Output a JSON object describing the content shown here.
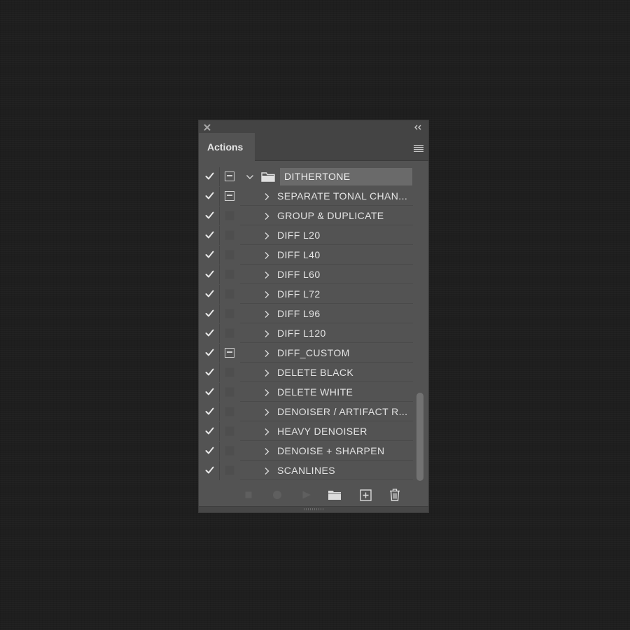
{
  "panel": {
    "tab_title": "Actions",
    "set": {
      "name": "DITHERTONE",
      "enabled": true,
      "dialog_on": true,
      "expanded": true
    },
    "actions": [
      {
        "label": "SEPARATE TONAL CHAN...",
        "enabled": true,
        "dialog_on": true
      },
      {
        "label": "GROUP & DUPLICATE",
        "enabled": true,
        "dialog_on": false
      },
      {
        "label": "DIFF L20",
        "enabled": true,
        "dialog_on": false
      },
      {
        "label": "DIFF L40",
        "enabled": true,
        "dialog_on": false
      },
      {
        "label": "DIFF L60",
        "enabled": true,
        "dialog_on": false
      },
      {
        "label": "DIFF L72",
        "enabled": true,
        "dialog_on": false
      },
      {
        "label": "DIFF L96",
        "enabled": true,
        "dialog_on": false
      },
      {
        "label": "DIFF L120",
        "enabled": true,
        "dialog_on": false
      },
      {
        "label": "DIFF_CUSTOM",
        "enabled": true,
        "dialog_on": true
      },
      {
        "label": "DELETE BLACK",
        "enabled": true,
        "dialog_on": false
      },
      {
        "label": "DELETE WHITE",
        "enabled": true,
        "dialog_on": false
      },
      {
        "label": "DENOISER / ARTIFACT R...",
        "enabled": true,
        "dialog_on": false
      },
      {
        "label": "HEAVY DENOISER",
        "enabled": true,
        "dialog_on": false
      },
      {
        "label": "DENOISE + SHARPEN",
        "enabled": true,
        "dialog_on": false
      },
      {
        "label": "SCANLINES",
        "enabled": true,
        "dialog_on": false
      }
    ],
    "footer_icons": [
      "stop-icon",
      "record-icon",
      "play-icon",
      "folder-icon",
      "new-action-icon",
      "trash-icon"
    ]
  },
  "colors": {
    "background": "#1e1e1e",
    "panel": "#535353",
    "header": "#444444",
    "selected_set": "#6a6a6a",
    "text": "#e4e4e4"
  }
}
